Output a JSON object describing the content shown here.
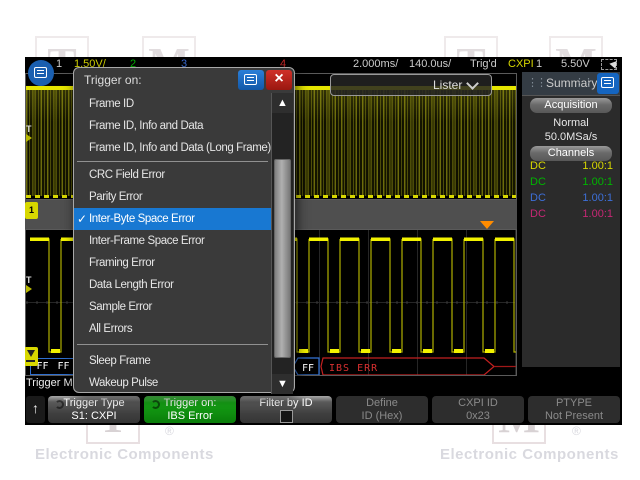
{
  "watermark": {
    "brand_text": "Electronic Components",
    "registered": "®",
    "top_letters": [
      "T",
      "M",
      "T",
      "M"
    ],
    "bottom_letters": [
      "T",
      "M"
    ]
  },
  "top_bar": {
    "ch1_num": "1",
    "ch1_scale": "1.50V/",
    "ch2_num": "2",
    "ch3_num": "3",
    "ch4_num": "4",
    "timebase": "2.000ms/",
    "delay": "140.0us/",
    "trig_status": "Trig'd",
    "trig_source": "CXPI",
    "trig_channel": "1",
    "trig_level": "5.50V"
  },
  "lister": {
    "label": "Lister"
  },
  "dialog": {
    "title": "Trigger on:",
    "items": [
      {
        "label": "Frame ID"
      },
      {
        "label": "Frame ID, Info and Data"
      },
      {
        "label": "Frame ID, Info and Data (Long Frame)"
      },
      {
        "label": "CRC Field Error"
      },
      {
        "label": "Parity Error"
      },
      {
        "label": "Inter-Byte Space Error",
        "selected": true,
        "check": "✓"
      },
      {
        "label": "Inter-Frame Space Error"
      },
      {
        "label": "Framing Error"
      },
      {
        "label": "Data Length Error"
      },
      {
        "label": "Sample Error"
      },
      {
        "label": "All Errors"
      },
      {
        "label": "Sleep Frame"
      },
      {
        "label": "Wakeup Pulse"
      }
    ],
    "close_glyph": "×",
    "scroll_up": "▲",
    "scroll_down": "▼"
  },
  "summary": {
    "title": "Summary",
    "grip": "⋮⋮",
    "acquisition_label": "Acquisition",
    "acq_mode": "Normal",
    "sample_rate": "50.0MSa/s",
    "channels_label": "Channels",
    "channels": [
      {
        "coupling": "DC",
        "probe": "1.00:1",
        "color": "#d8d800"
      },
      {
        "coupling": "DC",
        "probe": "1.00:1",
        "color": "#00b400"
      },
      {
        "coupling": "DC",
        "probe": "1.00:1",
        "color": "#3d6fd8"
      },
      {
        "coupling": "DC",
        "probe": "1.00:1",
        "color": "#c62774"
      }
    ]
  },
  "decode": {
    "left_bytes": "FF FF",
    "byte": "FF",
    "error": "IBS ERR"
  },
  "markers": {
    "trig_letter": "T",
    "bus_badge": "1"
  },
  "menu_label": "Trigger Men",
  "softkeys": {
    "up_arrow": "↑",
    "keys": [
      {
        "line1": "Trigger Type",
        "line2": "S1: CXPI",
        "style": "gray",
        "knob": true
      },
      {
        "line1": "Trigger on:",
        "line2": "IBS Error",
        "style": "green",
        "knob": true
      },
      {
        "line1": "Filter by ID",
        "line2": "",
        "style": "gray",
        "checkbox": true
      },
      {
        "line1": "Define",
        "line2": "ID (Hex)",
        "style": "dis"
      },
      {
        "line1": "CXPI ID",
        "line2": "0x23",
        "style": "dis"
      },
      {
        "line1": "PTYPE",
        "line2": "Not Present",
        "style": "dis"
      }
    ]
  }
}
